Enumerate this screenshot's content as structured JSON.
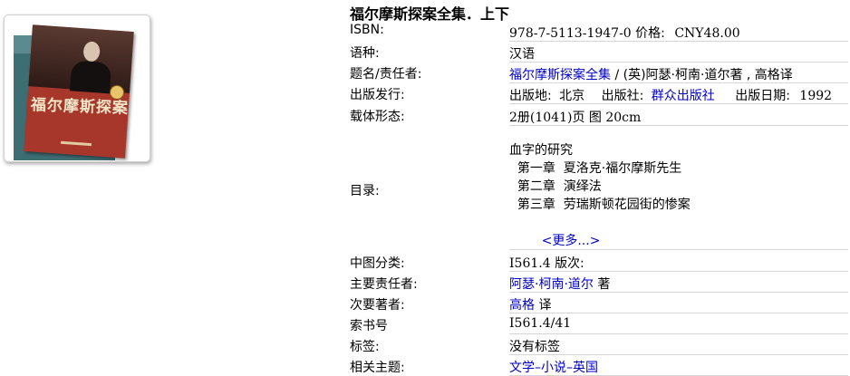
{
  "book": {
    "title": "福尔摩斯探案全集．上下",
    "cover": {
      "title_text": "福尔摩斯探案全集"
    }
  },
  "fields": {
    "isbn": {
      "label": "ISBN:",
      "isbn": "978-7-5113-1947-0",
      "price_label": "价格:",
      "price": "CNY48.00"
    },
    "language": {
      "label": "语种:",
      "value": "汉语"
    },
    "title_resp": {
      "label": "题名/责任者:",
      "title_link": "福尔摩斯探案全集",
      "rest": " / (英)阿瑟·柯南·道尔著 , 高格译"
    },
    "publication": {
      "label": "出版发行:",
      "place_label": "出版地:",
      "place": "北京",
      "publisher_label": "出版社:",
      "publisher": "群众出版社",
      "date_label": "出版日期:",
      "date": "1992"
    },
    "physical": {
      "label": "载体形态:",
      "value": "2册(1041)页 图 20cm"
    },
    "toc": {
      "label": "目录:",
      "lines": [
        "血字的研究",
        "  第一章  夏洛克·福尔摩斯先生",
        "  第二章  演绎法",
        "  第三章  劳瑞斯顿花园街的惨案"
      ],
      "more_link": "<更多...>",
      "more_paren_open": "(",
      "more_red": "更多",
      "more_paren_close": ")"
    },
    "classification": {
      "label": "中图分类:",
      "value": "I561.4",
      "edition_label": "版次:"
    },
    "main_resp": {
      "label": "主要责任者:",
      "link": "阿瑟·柯南·道尔",
      "role": "著"
    },
    "secondary_resp": {
      "label": "次要著者:",
      "link": "高格",
      "role": "译"
    },
    "call_number": {
      "label": "索书号",
      "value": "I561.4/41"
    },
    "tags": {
      "label": "标签:",
      "value": "没有标签"
    },
    "subject": {
      "label": "相关主题:",
      "link": "文学–小说–英国"
    }
  }
}
